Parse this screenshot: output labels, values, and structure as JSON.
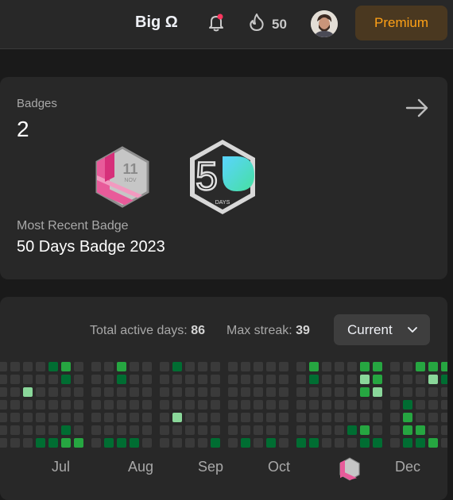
{
  "topbar": {
    "brand": "Big Ω",
    "streak_count": "50",
    "premium_label": "Premium"
  },
  "badges": {
    "label": "Badges",
    "count": "2",
    "badge1_text": "11",
    "badge1_sub": "NOV",
    "badge2_text": "5",
    "badge2_sub": "DAYS",
    "recent_label": "Most Recent Badge",
    "recent_name": "50 Days Badge 2023"
  },
  "calendar": {
    "total_label": "Total active days:",
    "total_value": "86",
    "streak_label": "Max streak:",
    "streak_value": "39",
    "range_selected": "Current",
    "months": [
      "Jul",
      "Aug",
      "Sep",
      "Oct",
      "Dec"
    ],
    "colors": {
      "empty": "#3a3a3a",
      "level1": "#0e4429",
      "level2": "#006d32",
      "level3": "#26a641",
      "level4": "#8ad79a"
    },
    "columns": [
      [
        0,
        0,
        0,
        0,
        0,
        0,
        0
      ],
      [
        0,
        0,
        0,
        0,
        0,
        0,
        0
      ],
      [
        0,
        0,
        4,
        0,
        0,
        0,
        0
      ],
      [
        0,
        0,
        0,
        0,
        0,
        0,
        2
      ],
      [
        2,
        0,
        0,
        0,
        0,
        0,
        2
      ],
      [
        3,
        2,
        0,
        0,
        0,
        2,
        3
      ],
      [
        0,
        0,
        0,
        0,
        0,
        0,
        3
      ],
      [
        0,
        0,
        0,
        0,
        0,
        0,
        0
      ],
      [
        0,
        0,
        0,
        0,
        0,
        0,
        2
      ],
      [
        3,
        2,
        0,
        0,
        0,
        0,
        2
      ],
      [
        0,
        0,
        0,
        0,
        0,
        0,
        2
      ],
      [
        0,
        0,
        0,
        0,
        0,
        0,
        0
      ],
      [
        0,
        0,
        0,
        0,
        0,
        0,
        0
      ],
      [
        2,
        0,
        0,
        0,
        4,
        0,
        0
      ],
      [
        0,
        0,
        0,
        0,
        0,
        0,
        0
      ],
      [
        0,
        0,
        0,
        0,
        0,
        0,
        0
      ],
      [
        0,
        0,
        0,
        0,
        0,
        0,
        2
      ],
      [
        0,
        0,
        0,
        0,
        0,
        0,
        0
      ],
      [
        0,
        0,
        0,
        0,
        0,
        0,
        2
      ],
      [
        0,
        0,
        0,
        0,
        0,
        0,
        0
      ],
      [
        0,
        0,
        0,
        0,
        0,
        0,
        2
      ],
      [
        0,
        0,
        0,
        0,
        0,
        0,
        0
      ],
      [
        0,
        0,
        0,
        0,
        0,
        0,
        2
      ],
      [
        3,
        2,
        0,
        0,
        0,
        0,
        2
      ],
      [
        0,
        0,
        0,
        0,
        0,
        0,
        0
      ],
      [
        0,
        0,
        0,
        0,
        0,
        0,
        0
      ],
      [
        0,
        0,
        0,
        0,
        0,
        2,
        0
      ],
      [
        3,
        4,
        3,
        0,
        0,
        3,
        2
      ],
      [
        3,
        3,
        4,
        0,
        0,
        0,
        2
      ],
      [
        0,
        0,
        0,
        0,
        0,
        0,
        0
      ],
      [
        0,
        0,
        0,
        2,
        3,
        3,
        2
      ],
      [
        3,
        0,
        0,
        0,
        0,
        3,
        2
      ],
      [
        3,
        4,
        0,
        0,
        0,
        0,
        3
      ],
      [
        3,
        2,
        0,
        0,
        0,
        0,
        0
      ],
      [
        3,
        2,
        3,
        3,
        2,
        0,
        0
      ],
      [
        0,
        2,
        0,
        0,
        2,
        0,
        0
      ],
      [
        0,
        0,
        0,
        0,
        0,
        0,
        2
      ],
      [
        0,
        0,
        0,
        0,
        2,
        3,
        2
      ],
      [
        0,
        2,
        0,
        0,
        0,
        4,
        2
      ]
    ]
  }
}
